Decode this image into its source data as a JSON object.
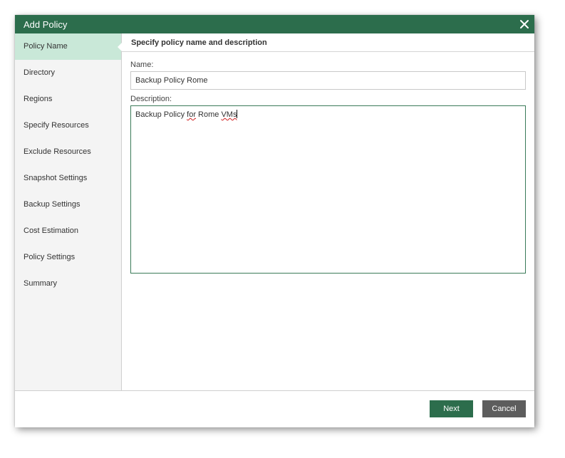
{
  "window": {
    "title": "Add Policy"
  },
  "sidebar": {
    "items": [
      {
        "label": "Policy Name",
        "active": true
      },
      {
        "label": "Directory"
      },
      {
        "label": "Regions"
      },
      {
        "label": "Specify Resources"
      },
      {
        "label": "Exclude Resources"
      },
      {
        "label": "Snapshot Settings"
      },
      {
        "label": "Backup Settings"
      },
      {
        "label": "Cost Estimation"
      },
      {
        "label": "Policy Settings"
      },
      {
        "label": "Summary"
      }
    ]
  },
  "main": {
    "step_title": "Specify policy name and description",
    "name_label": "Name:",
    "name_value": "Backup Policy Rome",
    "description_label": "Description:",
    "description_parts": {
      "part1": "Backup Policy ",
      "part2": "for",
      "part3": " Rome ",
      "part4": "VMs"
    }
  },
  "footer": {
    "next_label": "Next",
    "cancel_label": "Cancel"
  },
  "colors": {
    "accent": "#2c6d4c",
    "active_nav": "#c9e8d8",
    "cancel": "#5d5d5d"
  },
  "icons": {
    "close": "close-icon"
  }
}
